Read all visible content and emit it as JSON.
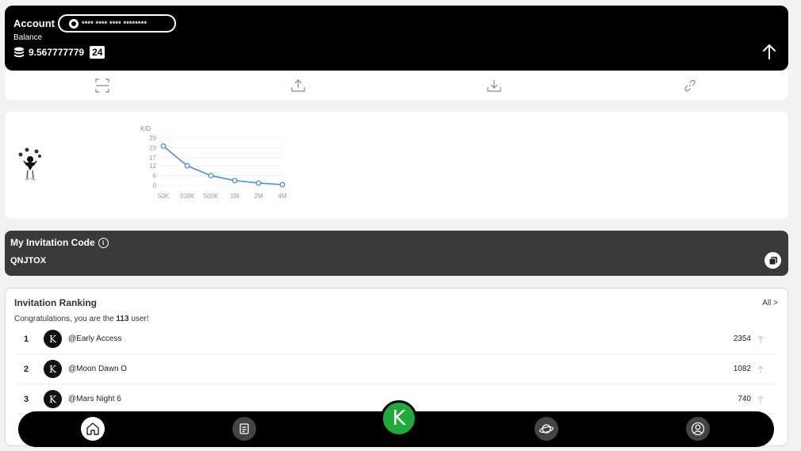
{
  "account": {
    "title": "Account",
    "masked_number": "**** **** **** ********",
    "balance_label": "Balance",
    "balance_value": "9.567777779",
    "balance_badge": "24",
    "up_icon": "arrow-up-icon"
  },
  "actions": {
    "items": [
      {
        "icon": "scan-icon"
      },
      {
        "icon": "upload-icon"
      },
      {
        "icon": "download-icon"
      },
      {
        "icon": "link-icon"
      }
    ]
  },
  "chart_data": {
    "type": "line",
    "ylabel": "K/D",
    "categories": [
      "50K",
      "100K",
      "500K",
      "1M",
      "2M",
      "4M"
    ],
    "values": [
      24,
      12,
      6,
      3,
      1.5,
      0.5
    ],
    "yticks": [
      "29",
      "23",
      "17",
      "12",
      "6",
      "0"
    ],
    "ylim": [
      0,
      29
    ],
    "grid": true,
    "line_color": "#4a90d9"
  },
  "invitation": {
    "title": "My Invitation Code",
    "code": "QNJTOX",
    "info_icon": "info-icon",
    "copy_icon": "copy-icon"
  },
  "ranking": {
    "title": "Invitation Ranking",
    "all_label": "All >",
    "subtitle_prefix": "Congratulations, you are the ",
    "subtitle_number": "113",
    "subtitle_suffix": " user!",
    "rows": [
      {
        "rank": "1",
        "name": "@Early Access",
        "score": "2354",
        "avatar": "K"
      },
      {
        "rank": "2",
        "name": "@Moon Dawn O",
        "score": "1082",
        "avatar": "K"
      },
      {
        "rank": "3",
        "name": "@Mars Night 6",
        "score": "740",
        "avatar": "K"
      }
    ]
  },
  "nav": {
    "center_label": "K",
    "items": [
      {
        "icon": "home-icon",
        "active": true
      },
      {
        "icon": "document-icon",
        "active": false
      },
      {
        "icon": "planet-icon",
        "active": false
      },
      {
        "icon": "profile-icon",
        "active": false
      }
    ]
  }
}
